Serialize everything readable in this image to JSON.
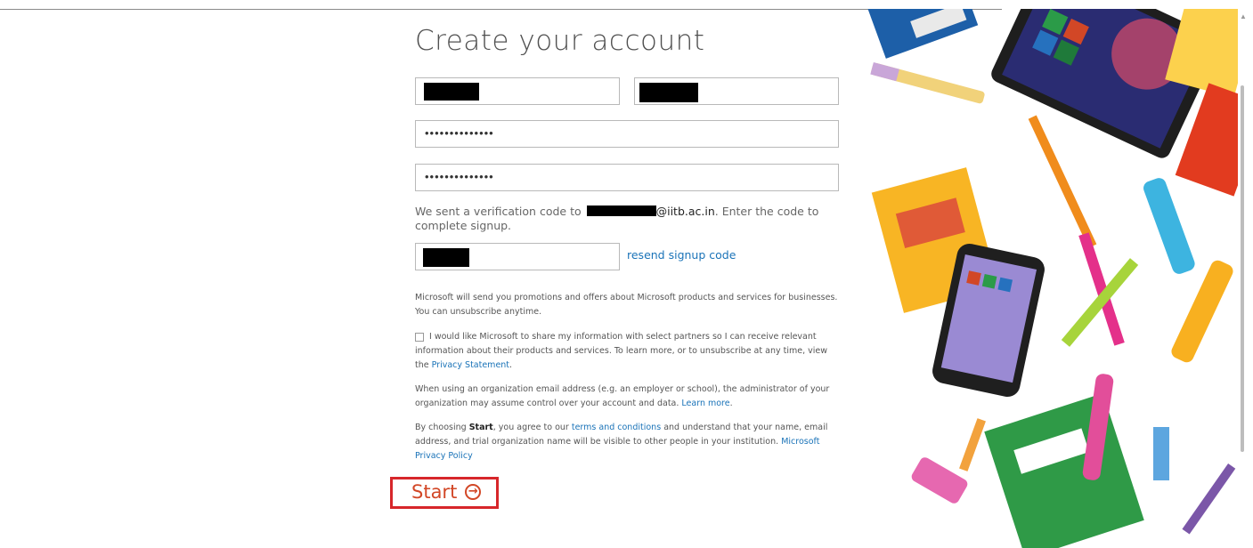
{
  "page": {
    "title": "Create your account"
  },
  "form": {
    "password_mask": "••••••••••••••",
    "confirm_password_mask": "••••••••••••••",
    "verification_text_prefix": "We sent a verification code to",
    "verification_email_suffix": "@iitb.ac.in",
    "verification_text_suffix": ". Enter the code to complete signup.",
    "resend_link": "resend signup code"
  },
  "legal": {
    "promo_text": "Microsoft will send you promotions and offers about Microsoft products and services for businesses. You can unsubscribe anytime.",
    "share_checkbox_text": "I would like Microsoft to share my information with select partners so I can receive relevant information about their products and services. To learn more, or to unsubscribe at any time, view the",
    "privacy_statement_link": "Privacy Statement",
    "org_email_text": "When using an organization email address (e.g. an employer or school), the administrator of your organization may assume control over your account and data.",
    "learn_more_link": "Learn more",
    "agree_prefix": "By choosing",
    "agree_bold": "Start",
    "agree_mid": ", you agree to our",
    "terms_link": "terms and conditions",
    "agree_rest": "and understand that your name, email address, and trial organization name will be visible to other people in your institution.",
    "privacy_policy_link": "Microsoft Privacy Policy"
  },
  "actions": {
    "start_label": "Start",
    "start_icon": "arrow-circle-right-icon"
  },
  "colors": {
    "accent": "#d24726",
    "link": "#1a73b8",
    "highlight_box": "#d7262a"
  }
}
